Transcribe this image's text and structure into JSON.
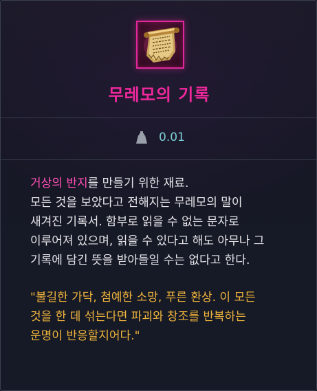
{
  "item": {
    "name": "무레모의 기록",
    "weight_value": "0.01",
    "icon": "scroll-icon"
  },
  "description": {
    "highlight": "거상의 반지",
    "line1_rest": "를 만들기 위한 재료.",
    "lines": [
      "모든 것을 보았다고 전해지는 무레모의 말이",
      "새겨진 기록서. 함부로 읽을 수 없는 문자로",
      "이루어져 있으며, 읽을 수 있다고 해도 아무나 그",
      "기록에 담긴 뜻을 받아들일 수는 없다고 한다."
    ]
  },
  "lore": {
    "lines": [
      "\"불길한 가닥, 첨예한 소망, 푸른 환상. 이 모든",
      "것을 한 데 섞는다면 파괴와 창조를 반복하는",
      "운명이 반응할지어다.\""
    ]
  },
  "colors": {
    "name": "#f0289c",
    "highlight": "#ff4fb5",
    "weight": "#7ed0d8",
    "lore": "#f0b43c",
    "frame": "#e0289c"
  },
  "icons": {
    "weight": "weight-icon",
    "item": "scroll-icon"
  }
}
